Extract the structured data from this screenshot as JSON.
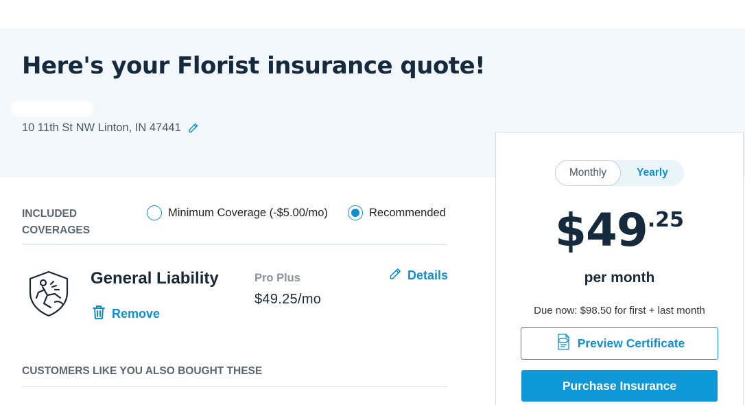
{
  "header": {
    "title": "Here's your Florist insurance quote!",
    "address": "10 11th St NW Linton, IN 47441",
    "edit_icon": "pencil-icon"
  },
  "coverages": {
    "label": "INCLUDED COVERAGES",
    "options": [
      {
        "label": "Minimum Coverage (-$5.00/mo)",
        "selected": false
      },
      {
        "label": "Recommended",
        "selected": true
      }
    ]
  },
  "policy": {
    "icon": "general-liability-shield-icon",
    "name": "General Liability",
    "tier": "Pro Plus",
    "price": "$49.25/mo",
    "remove_label": "Remove",
    "remove_icon": "trash-icon",
    "details_label": "Details",
    "details_icon": "pencil-icon"
  },
  "also_bought": {
    "label": "CUSTOMERS LIKE YOU ALSO BOUGHT THESE"
  },
  "summary": {
    "billing_toggle": {
      "monthly": "Monthly",
      "yearly": "Yearly",
      "active": "Monthly"
    },
    "price_dollars": "$49",
    "price_cents": ".25",
    "period": "per month",
    "due_now": "Due now: $98.50 for first + last month",
    "preview_label": "Preview Certificate",
    "preview_icon": "acord-certificate-icon",
    "purchase_label": "Purchase Insurance"
  },
  "colors": {
    "accent": "#0f8fd0",
    "primary_button": "#0f98d8",
    "heading": "#162a3d",
    "hero_background": "#f2f7fb"
  }
}
